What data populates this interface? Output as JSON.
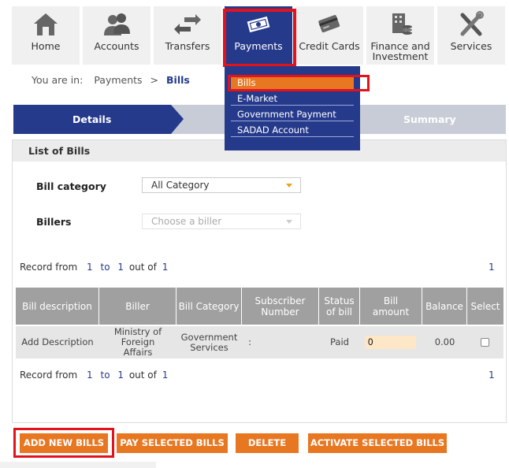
{
  "nav": {
    "items": [
      {
        "label": "Home",
        "icon": "home-icon"
      },
      {
        "label": "Accounts",
        "icon": "users-icon"
      },
      {
        "label": "Transfers",
        "icon": "transfer-arrows-icon"
      },
      {
        "label": "Payments",
        "icon": "money-icon"
      },
      {
        "label": "Credit Cards",
        "icon": "credit-card-icon"
      },
      {
        "label": "Finance and Investment",
        "icon": "finance-icon"
      },
      {
        "label": "Services",
        "icon": "tools-icon"
      }
    ],
    "active_color": "#263a8c"
  },
  "breadcrumb": {
    "prefix": "You are in:",
    "parent": "Payments",
    "separator": ">",
    "current": "Bills"
  },
  "payments_menu": {
    "items": [
      "Bills",
      "E-Market",
      "Government Payment",
      "SADAD Account"
    ],
    "selected": "Bills"
  },
  "steps": {
    "first": "Details",
    "last": "Summary"
  },
  "panel": {
    "title": "List of Bills",
    "bill_category": {
      "label": "Bill category",
      "value": "All Category"
    },
    "billers": {
      "label": "Billers",
      "placeholder": "Choose a biller"
    }
  },
  "record_info": {
    "prefix": "Record from",
    "from": "1",
    "to_word": "to",
    "to": "1",
    "out_of": "out of",
    "total": "1",
    "page": "1"
  },
  "table": {
    "headers": [
      "Bill description",
      "Biller",
      "Bill Category",
      "Subscriber Number",
      "Status of bill",
      "Bill amount",
      "Balance",
      "Select"
    ],
    "rows": [
      {
        "description": "Add Description",
        "biller": "Ministry of Foreign Affairs",
        "category": "Government Services",
        "subscriber": ":",
        "status": "Paid",
        "amount": "0",
        "balance": "0.00"
      }
    ]
  },
  "buttons": {
    "add_new": "ADD NEW BILLS",
    "pay_selected": "PAY SELECTED BILLS",
    "delete": "DELETE",
    "activate_selected": "ACTIVATE SELECTED BILLS"
  },
  "colors": {
    "brand_blue": "#263a8c",
    "accent_orange": "#e87722",
    "highlight_red": "#e3121b"
  }
}
